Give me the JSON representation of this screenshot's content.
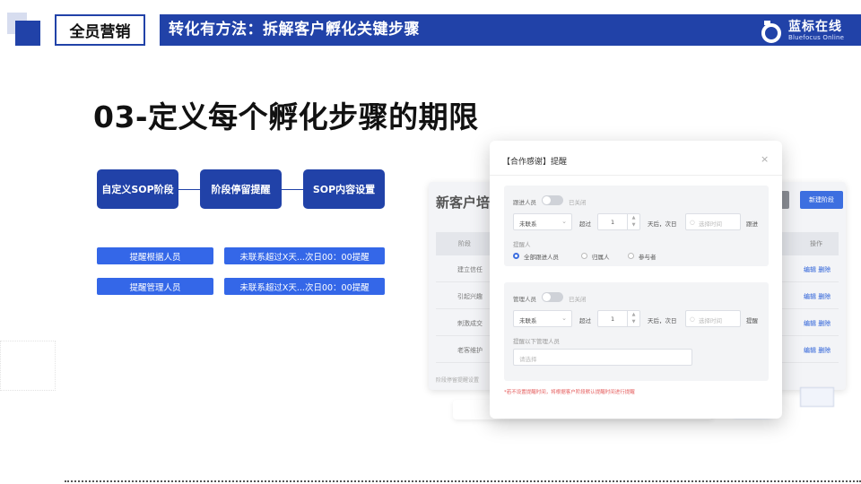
{
  "header": {
    "tag": "全员营销",
    "title": "转化有方法：拆解客户孵化关键步骤",
    "brand_name": "蓝标在线",
    "brand_sub": "Bluefocus Online"
  },
  "heading": "03-定义每个孵化步骤的期限",
  "flow": {
    "steps": [
      "自定义SOP阶段",
      "阶段停留提醒",
      "SOP内容设置"
    ]
  },
  "tags": [
    {
      "left": "提醒根据人员",
      "right": "未联系超过X天...次日00：00提醒"
    },
    {
      "left": "提醒管理人员",
      "right": "未联系超过X天...次日00：00提醒"
    }
  ],
  "background_panel": {
    "title": "新客户培",
    "button_label": "新建阶段",
    "col_name": "阶段",
    "col_action": "操作",
    "rows": [
      {
        "name": "建立信任",
        "actions": "编辑  删除"
      },
      {
        "name": "引起兴趣",
        "actions": "编辑  删除"
      },
      {
        "name": "刺激成交",
        "actions": "编辑  删除"
      },
      {
        "name": "老客维护",
        "actions": "编辑  删除"
      }
    ],
    "footer": "阶段停留提醒设置"
  },
  "dialog": {
    "title": "【合作感谢】提醒",
    "close": "×",
    "section1": {
      "label": "跟进人员",
      "toggle_state": "已关闭",
      "select": "未联系",
      "over_label": "超过",
      "days": "1",
      "after_label": "天后，次日",
      "time_placeholder": "选择时间",
      "end_label": "跟进",
      "notify_label": "提醒人",
      "radios": [
        "全部跟进人员",
        "归属人",
        "参与者"
      ]
    },
    "section2": {
      "label": "管理人员",
      "toggle_state": "已关闭",
      "select": "未联系",
      "over_label": "超过",
      "days": "1",
      "after_label": "天后，次日",
      "time_placeholder": "选择时间",
      "end_label": "提醒",
      "notify_label": "提醒以下管理人员",
      "input_placeholder": "请选择"
    },
    "warning": "*若不设置提醒时间，将根据客户阶段默认提醒时间进行提醒"
  }
}
